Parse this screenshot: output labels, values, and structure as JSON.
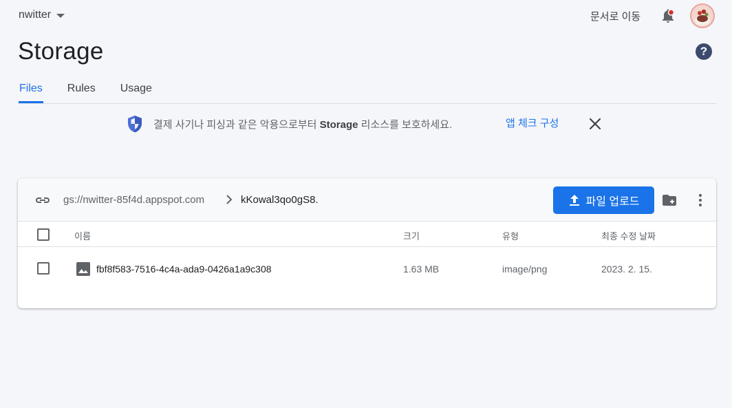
{
  "topbar": {
    "project_name": "nwitter",
    "docs_link": "문서로 이동",
    "notification_color": "#d93025"
  },
  "page": {
    "title": "Storage",
    "help_glyph": "?"
  },
  "tabs": [
    {
      "label": "Files",
      "active": true
    },
    {
      "label": "Rules",
      "active": false
    },
    {
      "label": "Usage",
      "active": false
    }
  ],
  "banner": {
    "text_before": "결제 사기나 피싱과 같은 악용으로부터 ",
    "text_bold": "Storage",
    "text_after": " 리소스를 보호하세요.",
    "action": "앱 체크 구성"
  },
  "browser": {
    "bucket": "gs://nwitter-85f4d.appspot.com",
    "folder": "kKowal3qo0gS8.",
    "upload_label": "파일 업로드",
    "columns": {
      "name": "이름",
      "size": "크기",
      "type": "유형",
      "modified": "최종 수정 날짜"
    },
    "rows": [
      {
        "name": "fbf8f583-7516-4c4a-ada9-0426a1a9c308",
        "size": "1.63 MB",
        "type": "image/png",
        "modified": "2023. 2. 15."
      }
    ]
  },
  "colors": {
    "accent": "#1a73e8",
    "background": "#f5f6f9"
  }
}
